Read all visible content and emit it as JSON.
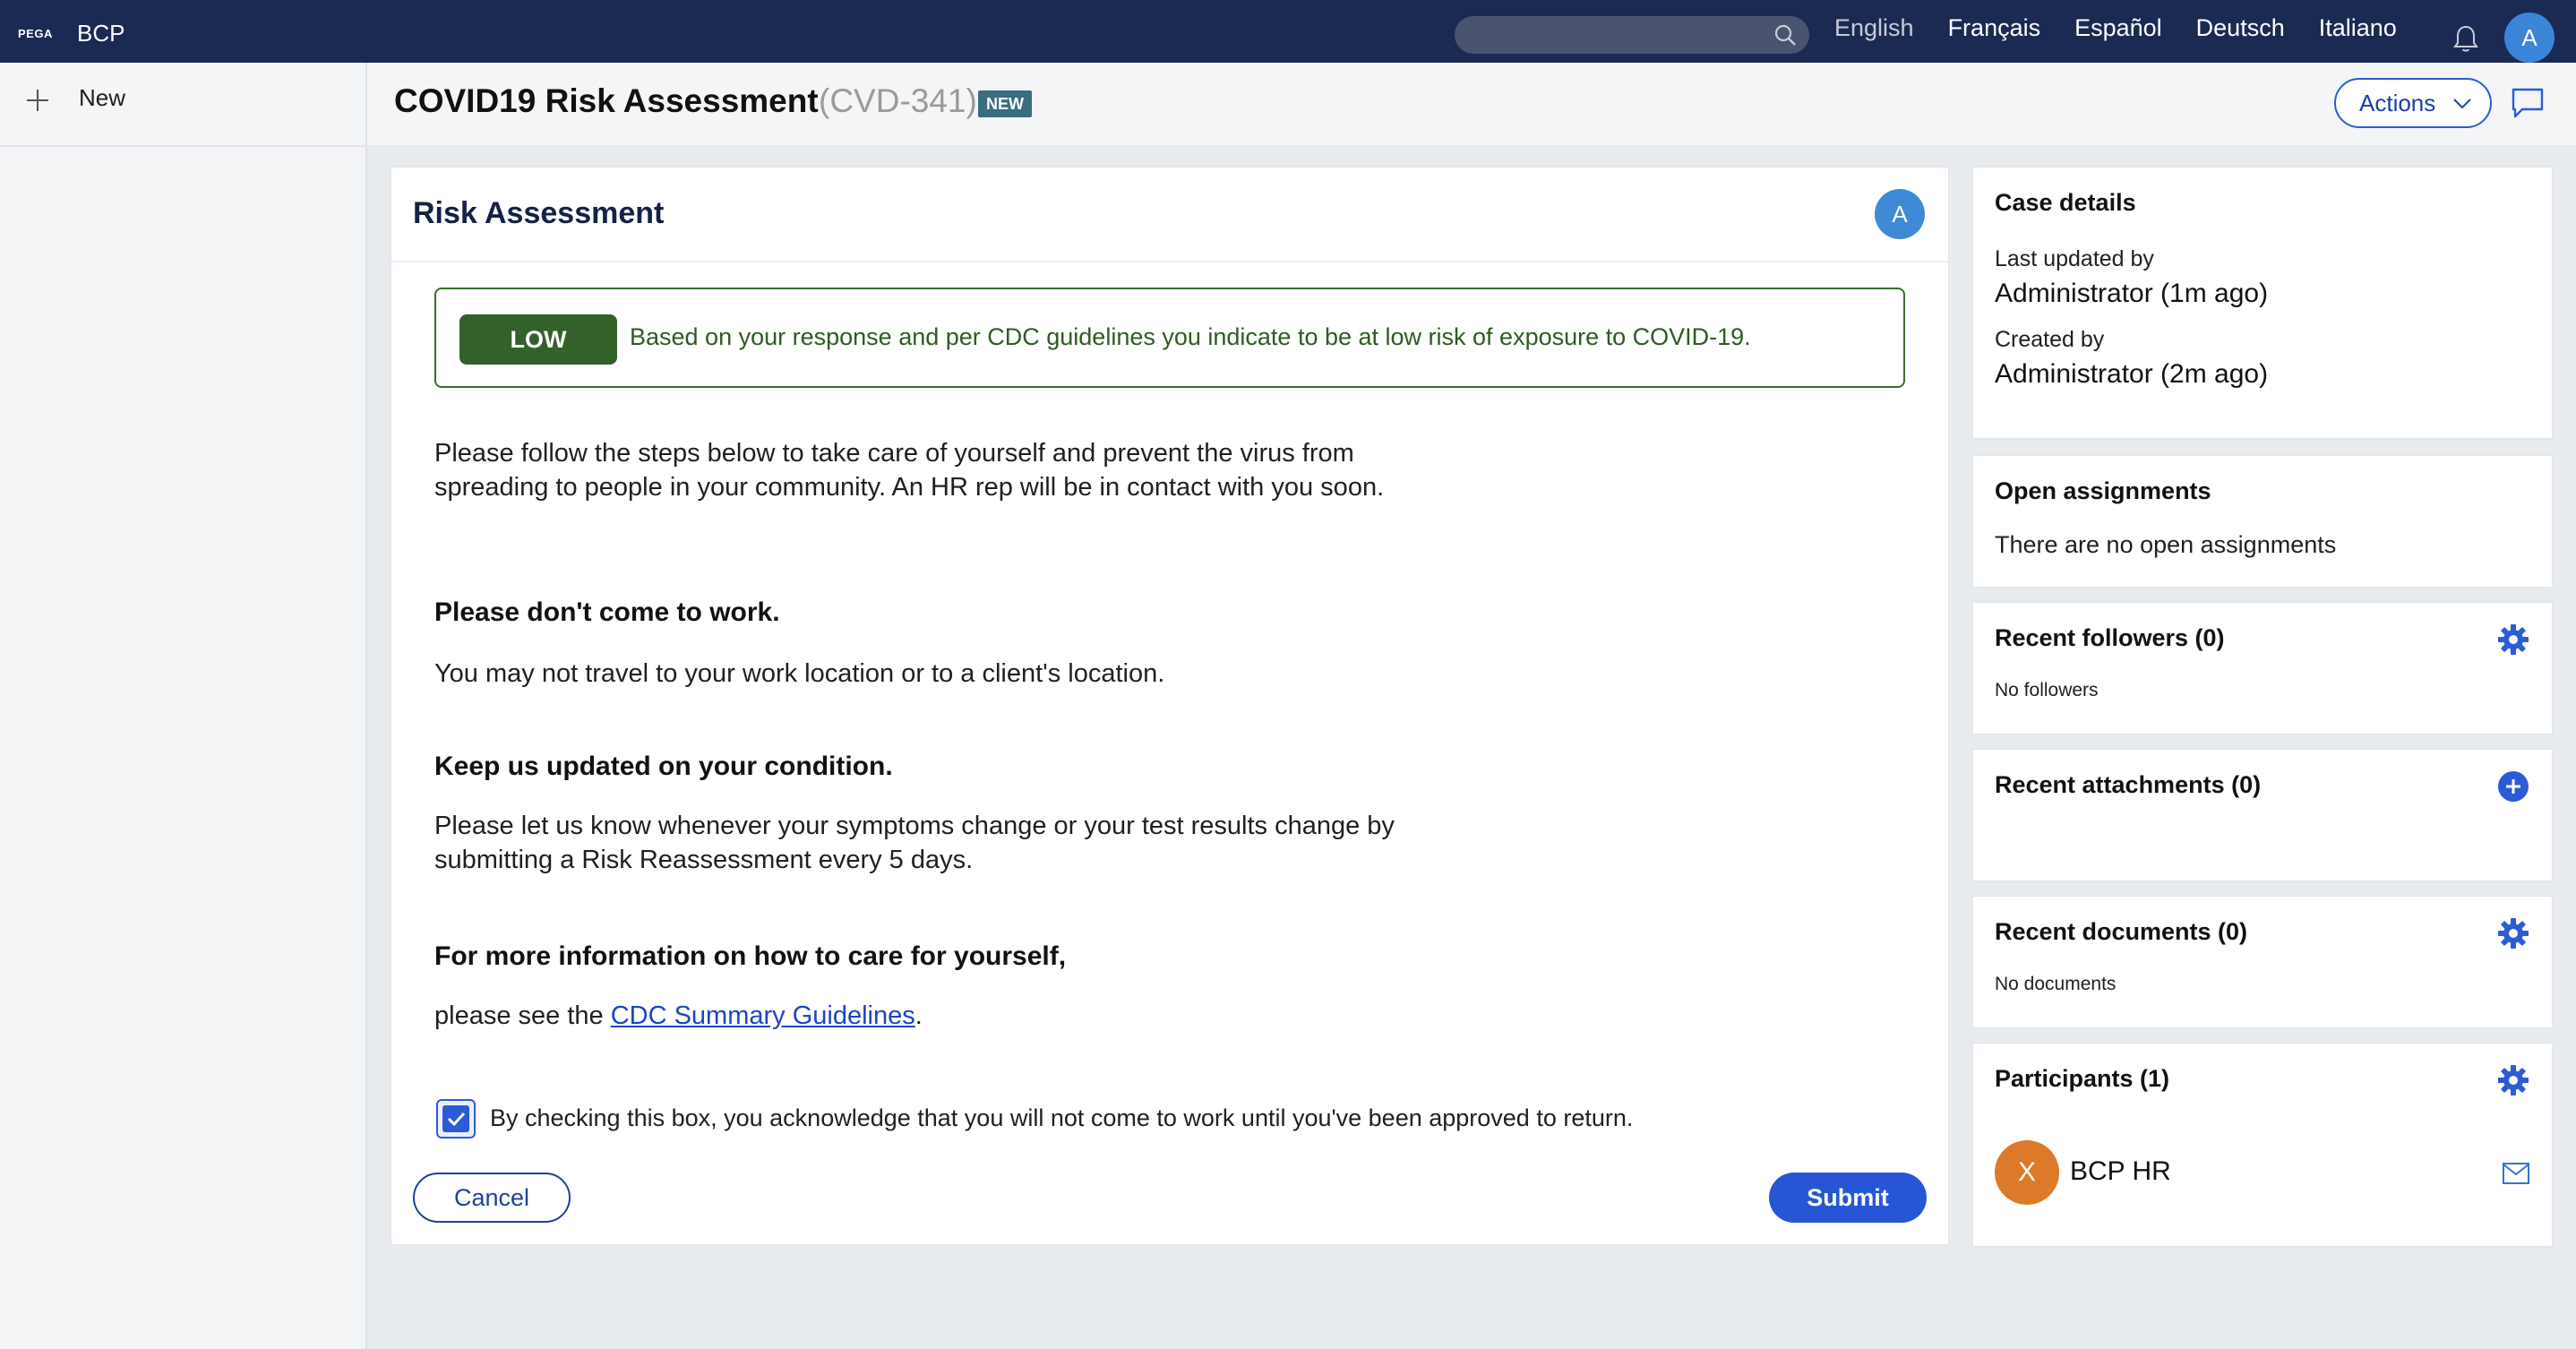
{
  "topbar": {
    "logo": "PEGA",
    "app_name": "BCP",
    "search_placeholder": "",
    "languages": [
      "English",
      "Français",
      "Español",
      "Deutsch",
      "Italiano"
    ],
    "active_language": "English",
    "user_initial": "A"
  },
  "sidebar": {
    "new_label": "New"
  },
  "header": {
    "title": "COVID19 Risk Assessment",
    "case_id": "(CVD-341)",
    "badge": "NEW",
    "actions_label": "Actions"
  },
  "assessment": {
    "title": "Risk Assessment",
    "assignee_initial": "A",
    "risk_level": "LOW",
    "risk_message": "Based on your response and per CDC guidelines you indicate to be at low risk of exposure to COVID-19.",
    "intro": "Please follow the steps below to take care of yourself and prevent the virus from spreading to people in your community. An HR rep will be in contact with you soon.",
    "section1_heading": "Please don't come to work.",
    "section1_text": "You may not travel to your work location or to a client's location.",
    "section2_heading": "Keep us updated on your condition.",
    "section2_text": "Please let us know whenever your symptoms change or your test results change by submitting a Risk Reassessment every 5 days.",
    "section3_heading": "For more information on how to care for yourself,",
    "section3_prefix": "please see the ",
    "section3_link": "CDC Summary Guidelines",
    "section3_suffix": ".",
    "acknowledge_label": "By checking this box, you acknowledge that you will not come to work until you've been approved to return.",
    "acknowledge_checked": true,
    "cancel_label": "Cancel",
    "submit_label": "Submit"
  },
  "case_details": {
    "title": "Case details",
    "last_updated_label": "Last updated by",
    "last_updated_value": "Administrator (1m ago)",
    "created_label": "Created by",
    "created_value": "Administrator (2m ago)"
  },
  "open_assignments": {
    "title": "Open assignments",
    "text": "There are no open assignments"
  },
  "followers": {
    "title": "Recent followers (0)",
    "empty": "No followers"
  },
  "attachments": {
    "title": "Recent attachments (0)"
  },
  "documents": {
    "title": "Recent documents (0)",
    "empty": "No documents"
  },
  "participants": {
    "title": "Participants (1)",
    "items": [
      {
        "initial": "X",
        "name": "BCP HR"
      }
    ]
  },
  "colors": {
    "topbar": "#1b2a52",
    "accent": "#2656d6",
    "risk_low": "#33612a",
    "participant_avatar": "#dc7a2a"
  }
}
